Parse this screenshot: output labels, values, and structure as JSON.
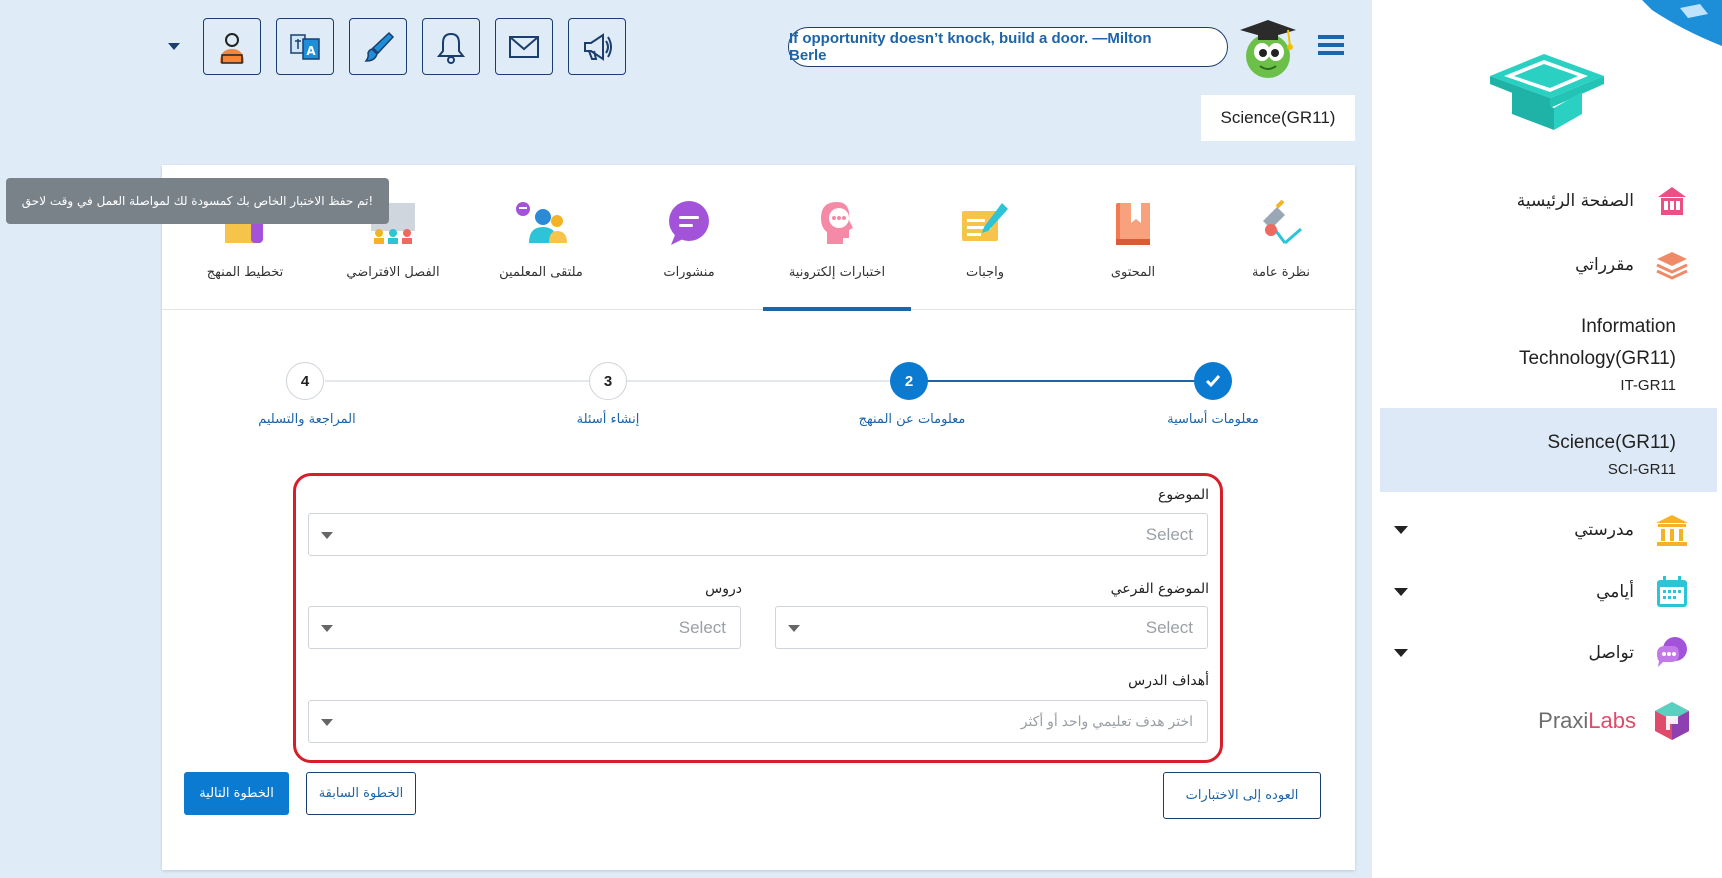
{
  "toolbar": {
    "quote": "If opportunity doesn’t knock, build a door. —Milton Berle",
    "course_chip": "Science(GR11)",
    "icons": [
      "megaphone-icon",
      "mail-icon",
      "bell-icon",
      "brush-icon",
      "translate-icon",
      "teacher-profile-icon"
    ]
  },
  "sidebar": {
    "nav": [
      {
        "label": "الصفحة الرئيسية",
        "icon": "home-icon"
      },
      {
        "label": "مقرراتي",
        "icon": "courses-stack-icon"
      }
    ],
    "courses": [
      {
        "title_line1": "Information",
        "title_line2": "Technology(GR11)",
        "code": "IT-GR11"
      },
      {
        "title_line1": "Science(GR11)",
        "code": "SCI-GR11"
      }
    ],
    "groups": [
      {
        "label": "مدرستي",
        "icon": "school-icon"
      },
      {
        "label": "أيامي",
        "icon": "calendar-icon"
      },
      {
        "label": "تواصل",
        "icon": "chat-icon"
      }
    ],
    "partner": {
      "label_a": "Praxi",
      "label_b": "Labs"
    }
  },
  "tabs": [
    {
      "label": "نظرة عامة",
      "icon": "overview-lamp-icon"
    },
    {
      "label": "المحتوى",
      "icon": "book-icon"
    },
    {
      "label": "واجبات",
      "icon": "assignment-pen-icon"
    },
    {
      "label": "اختبارات إلكترونية",
      "icon": "quiz-head-icon",
      "active": true
    },
    {
      "label": "منشورات",
      "icon": "posts-bubble-icon"
    },
    {
      "label": "ملتقى المعلمين",
      "icon": "teachers-forum-icon"
    },
    {
      "label": "الفصل الافتراضي",
      "icon": "virtual-class-icon"
    },
    {
      "label": "تخطيط المنهج",
      "icon": "curriculum-planning-icon"
    }
  ],
  "toast": "!تم حفظ الاختبار الخاص بك كمسودة لك لمواصلة العمل في وقت لاحق",
  "steps": [
    {
      "label": "معلومات أساسية",
      "number": "",
      "state": "done"
    },
    {
      "label": "معلومات عن المنهج",
      "number": "2",
      "state": "current"
    },
    {
      "label": "إنشاء أسئلة",
      "number": "3",
      "state": "pending"
    },
    {
      "label": "المراجعة والتسليم",
      "number": "4",
      "state": "pending"
    }
  ],
  "form": {
    "topic": {
      "label": "الموضوع",
      "placeholder": "Select"
    },
    "subtopic": {
      "label": "الموضوع الفرعي",
      "placeholder": "Select"
    },
    "lessons": {
      "label": "دروس",
      "placeholder": "Select"
    },
    "objectives": {
      "label": "أهداف الدرس",
      "placeholder": "اختر هدف تعليمي واحد أو أكثر"
    }
  },
  "buttons": {
    "back_to_quizzes": "العوده إلى الاختبارات",
    "previous": "الخطوة السابقة",
    "next": "الخطوة التالية"
  },
  "colors": {
    "primary": "#0b7ad1",
    "dark_blue": "#1c3e6e",
    "highlight_red": "#d71e2b",
    "page_bg": "#dfecf8"
  }
}
